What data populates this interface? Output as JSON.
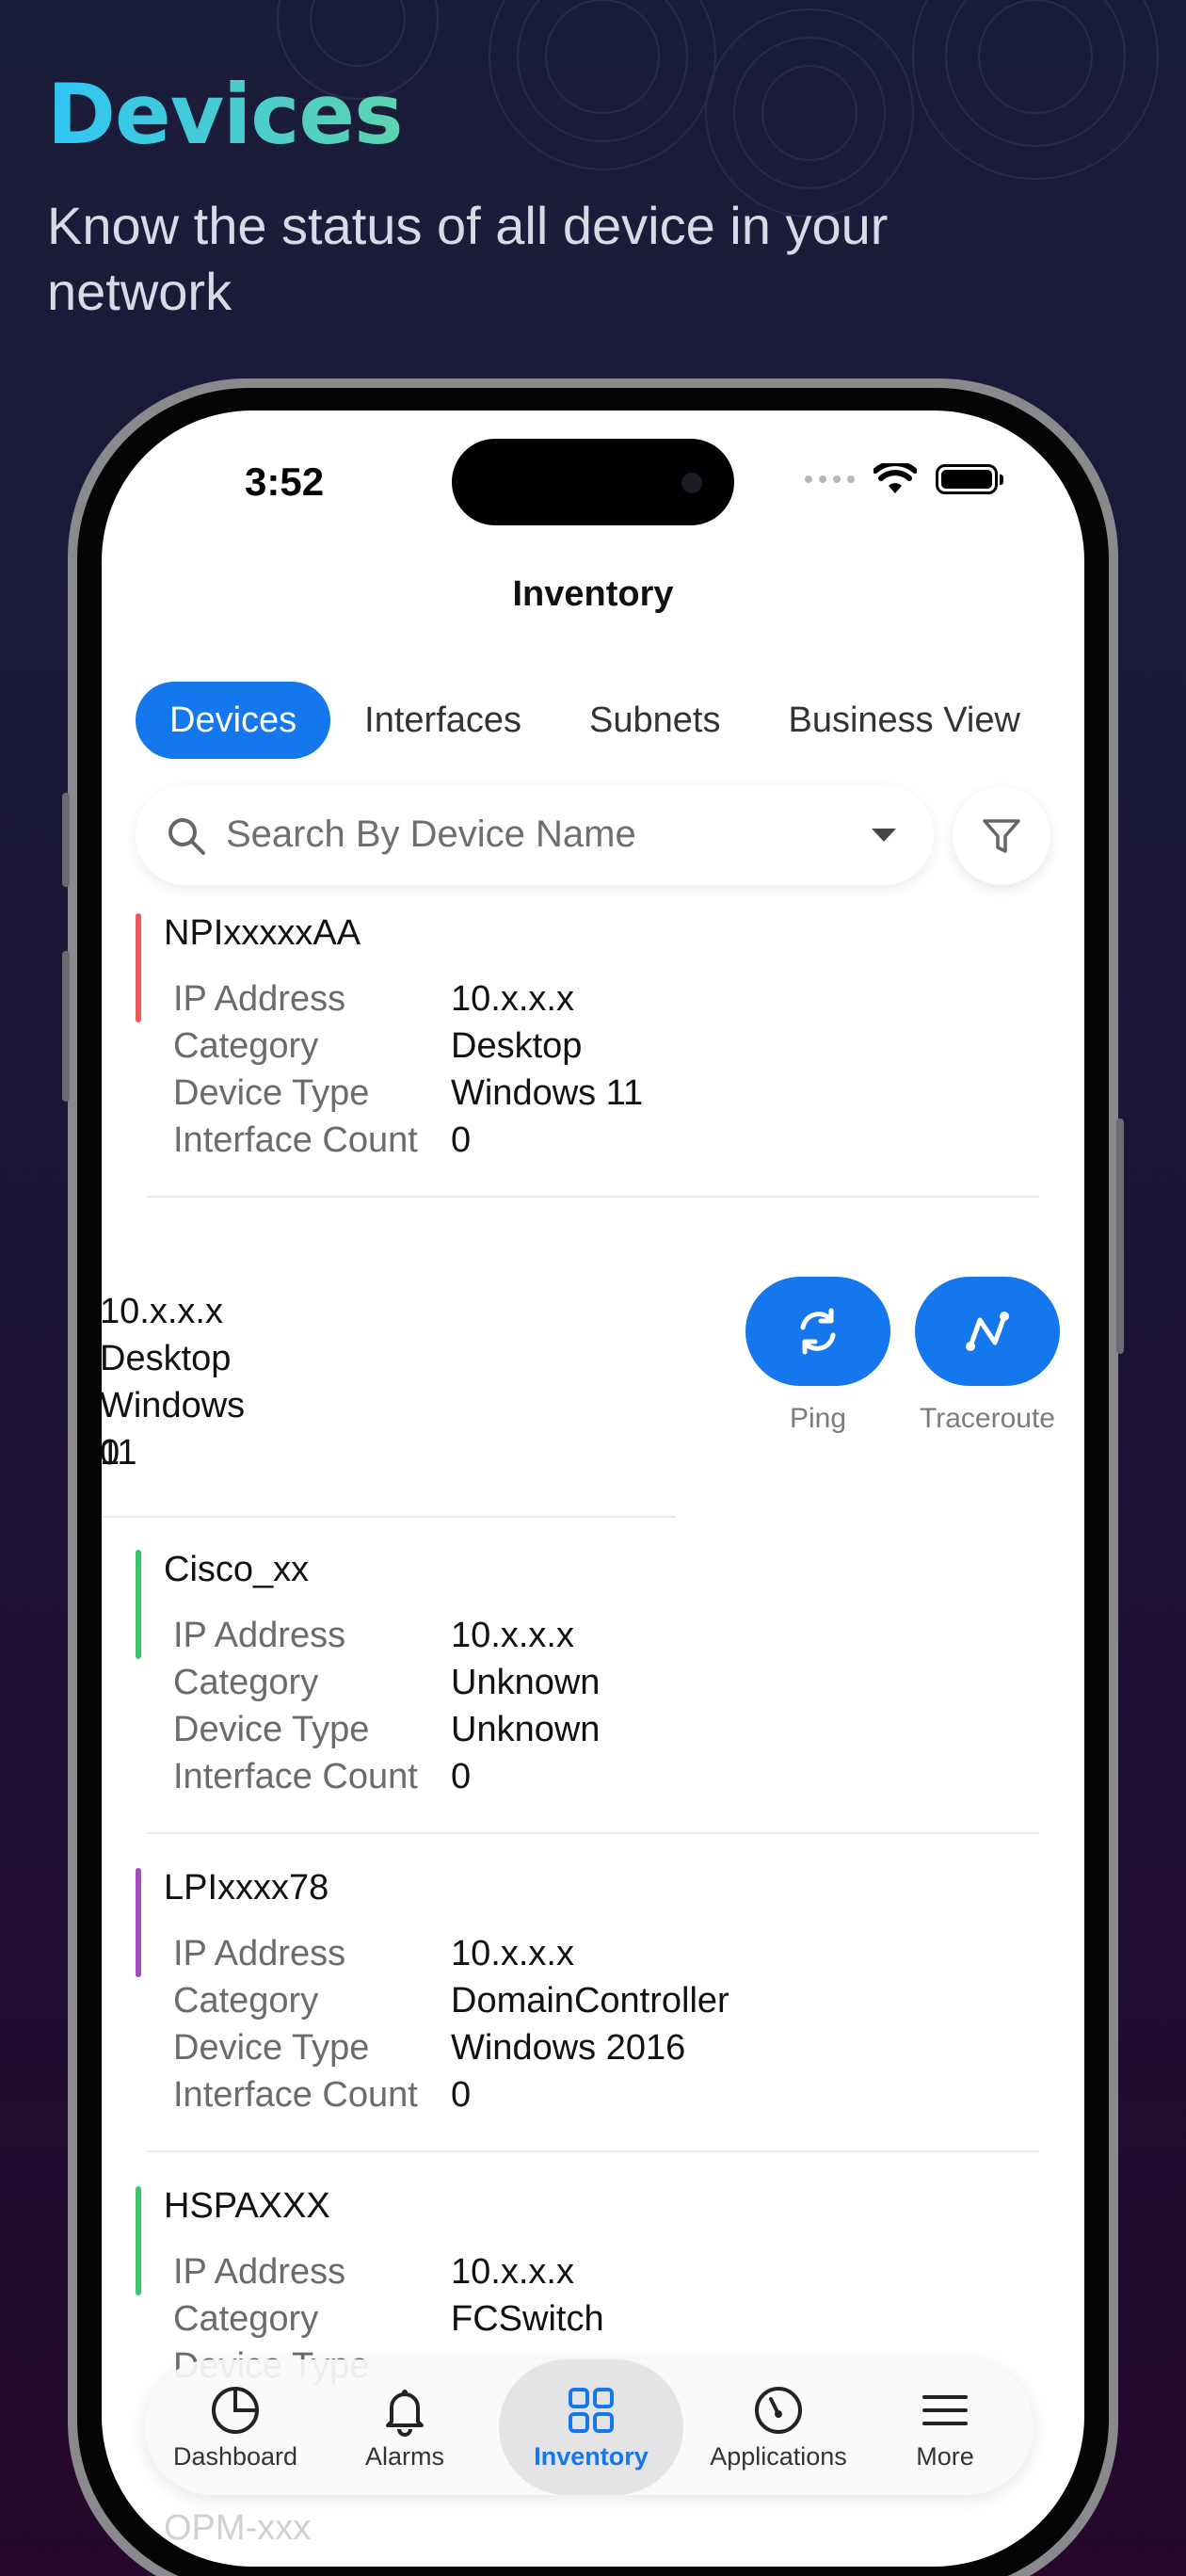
{
  "hero": {
    "title": "Devices",
    "subtitle": "Know the status of all device in your network"
  },
  "status_bar": {
    "time": "3:52"
  },
  "nav": {
    "title": "Inventory"
  },
  "tabs": [
    {
      "label": "Devices",
      "active": true
    },
    {
      "label": "Interfaces",
      "active": false
    },
    {
      "label": "Subnets",
      "active": false
    },
    {
      "label": "Business View",
      "active": false
    }
  ],
  "search": {
    "placeholder": "Search By Device Name"
  },
  "field_labels": {
    "ip": "IP Address",
    "category": "Category",
    "device_type": "Device Type",
    "interface_count": "Interface Count"
  },
  "devices": [
    {
      "name": "NPIxxxxxAA",
      "ip": "10.x.x.x",
      "category": "Desktop",
      "device_type": "Windows 11",
      "interface_count": "0",
      "status_color": "#ee5a5a"
    },
    {
      "name": "",
      "ip": "10.x.x.x",
      "category": "Desktop",
      "device_type": "Windows 11",
      "interface_count": "0",
      "status_color": ""
    },
    {
      "name": "Cisco_xx",
      "ip": "10.x.x.x",
      "category": "Unknown",
      "device_type": "Unknown",
      "interface_count": "0",
      "status_color": "#3cc46a"
    },
    {
      "name": "LPIxxxx78",
      "ip": "10.x.x.x",
      "category": "DomainController",
      "device_type": "Windows 2016",
      "interface_count": "0",
      "status_color": "#a64bc0"
    },
    {
      "name": "HSPAXXX",
      "ip": "10.x.x.x",
      "category": "FCSwitch",
      "device_type": "",
      "interface_count": "",
      "status_color": "#3cc46a"
    }
  ],
  "swipe_actions": [
    {
      "label": "Ping",
      "icon": "refresh-icon"
    },
    {
      "label": "Traceroute",
      "icon": "route-icon"
    }
  ],
  "tabbar": [
    {
      "label": "Dashboard",
      "icon": "pie-chart-icon",
      "active": false
    },
    {
      "label": "Alarms",
      "icon": "bell-icon",
      "active": false
    },
    {
      "label": "Inventory",
      "icon": "grid-icon",
      "active": true
    },
    {
      "label": "Applications",
      "icon": "gauge-icon",
      "active": false
    },
    {
      "label": "More",
      "icon": "menu-icon",
      "active": false
    }
  ],
  "partial": {
    "next_device_name": "OPM-xxx"
  },
  "colors": {
    "accent": "#1477ee",
    "critical": "#ee5a5a",
    "clear": "#3cc46a",
    "attention": "#a64bc0"
  }
}
